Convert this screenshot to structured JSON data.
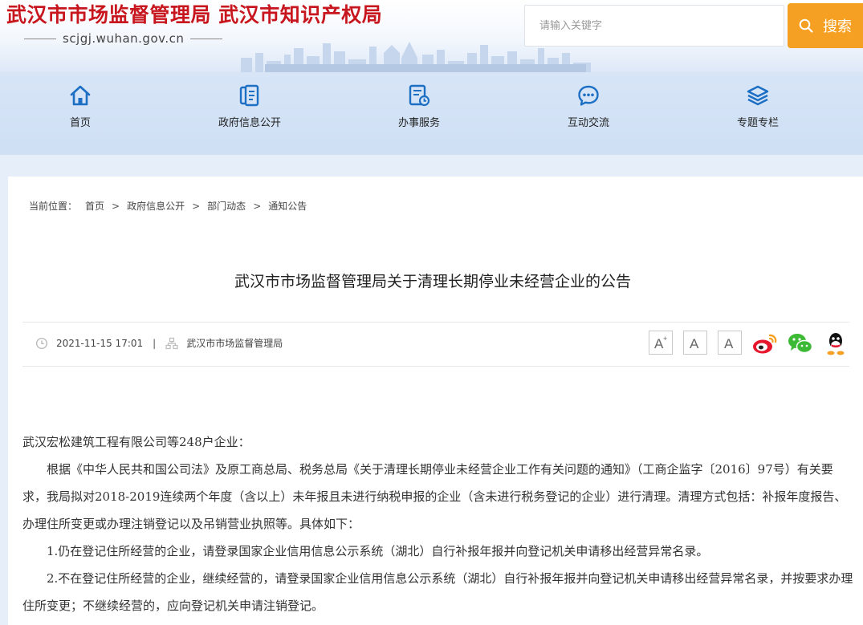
{
  "site": {
    "title": "武汉市市场监督管理局 武汉市知识产权局",
    "domain": "scjgj.wuhan.gov.cn",
    "brand_red": "#c8161e"
  },
  "search": {
    "placeholder": "请输入关键字",
    "button_label": "搜索",
    "button_color": "#f5a022"
  },
  "nav": {
    "icon_color": "#1d6fc4",
    "items": [
      {
        "label": "首页",
        "icon": "home-icon"
      },
      {
        "label": "政府信息公开",
        "icon": "documents-icon"
      },
      {
        "label": "办事服务",
        "icon": "service-form-icon"
      },
      {
        "label": "互动交流",
        "icon": "chat-bubble-icon"
      },
      {
        "label": "专题专栏",
        "icon": "layers-icon"
      }
    ]
  },
  "breadcrumb": {
    "prefix": "当前位置：",
    "items": [
      "首页",
      "政府信息公开",
      "部门动态",
      "通知公告"
    ],
    "separator": ">"
  },
  "article": {
    "title": "武汉市市场监督管理局关于清理长期停业未经营企业的公告",
    "date": "2021-11-15 17:01",
    "meta_divider": "|",
    "source": "武汉市市场监督管理局",
    "font_size_buttons": [
      "A+",
      "A",
      "A-"
    ],
    "share_icons": [
      "weibo-icon",
      "wechat-icon",
      "qq-icon"
    ],
    "paragraphs": [
      "武汉宏松建筑工程有限公司等248户企业：",
      "根据《中华人民共和国公司法》及原工商总局、税务总局《关于清理长期停业未经营企业工作有关问题的通知》（工商企监字〔2016〕97号）有关要求，我局拟对2018-2019连续两个年度（含以上）未年报且未进行纳税申报的企业（含未进行税务登记的企业）进行清理。清理方式包括：补报年度报告、办理住所变更或办理注销登记以及吊销营业执照等。具体如下：",
      "1.仍在登记住所经营的企业，请登录国家企业信用信息公示系统（湖北）自行补报年报并向登记机关申请移出经营异常名录。",
      "2.不在登记住所经营的企业，继续经营的，请登录国家企业信用信息公示系统（湖北）自行补报年报并向登记机关申请移出经营异常名录，并按要求办理住所变更；不继续经营的，应向登记机关申请注销登记。"
    ]
  }
}
